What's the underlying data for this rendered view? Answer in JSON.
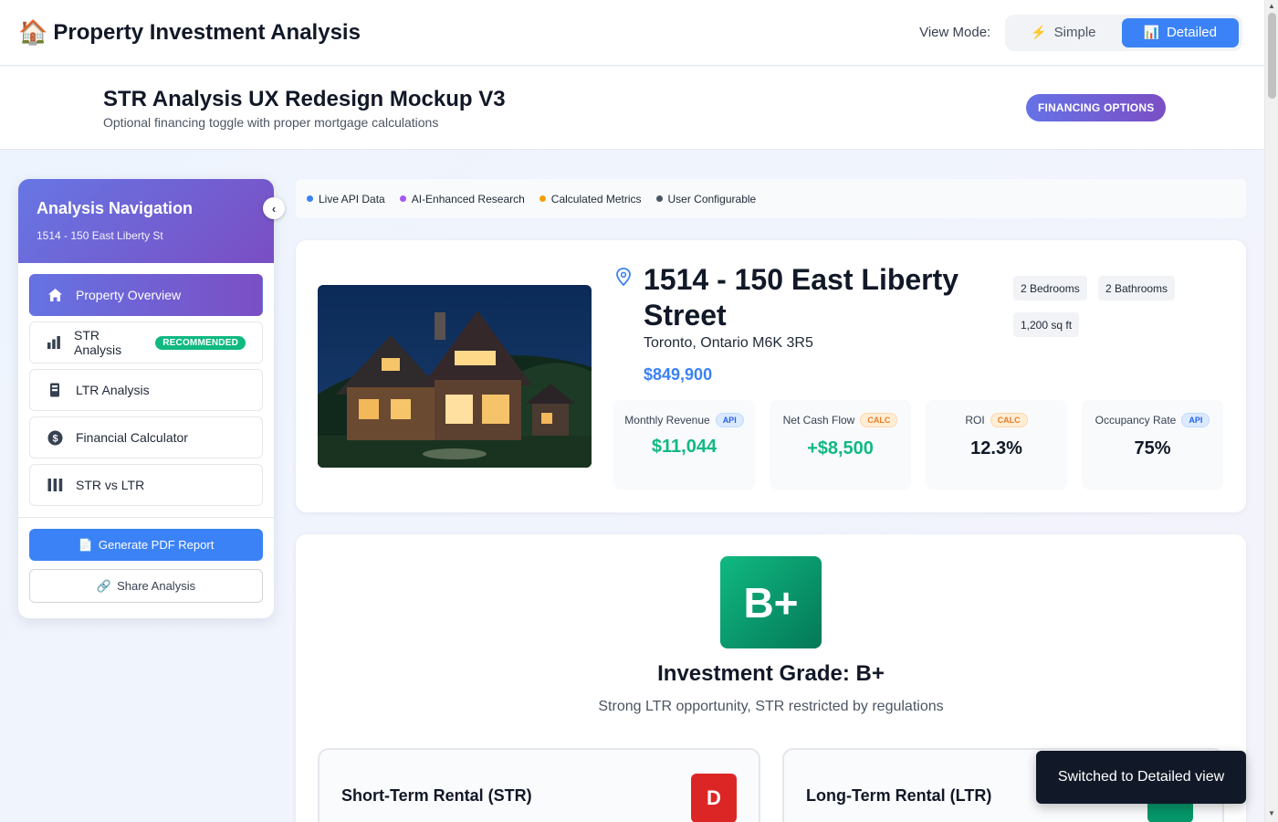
{
  "header": {
    "app_icon": "house-emoji",
    "app_emoji": "🏠",
    "app_title": "Property Investment Analysis",
    "view_mode_label": "View Mode:",
    "view_modes": [
      {
        "label": "Simple",
        "icon": "⚡",
        "active": false
      },
      {
        "label": "Detailed",
        "icon": "📊",
        "active": true
      }
    ]
  },
  "banner": {
    "title": "STR Analysis UX Redesign Mockup V3",
    "subtitle": "Optional financing toggle with proper mortgage calculations",
    "pill": "FINANCING OPTIONS"
  },
  "sidebar": {
    "title": "Analysis Navigation",
    "subtitle": "1514 - 150 East Liberty St",
    "collapse_glyph": "‹",
    "items": [
      {
        "label": "Property Overview",
        "icon": "home-icon",
        "active": true
      },
      {
        "label": "STR Analysis",
        "icon": "bar-chart-icon",
        "badge": "RECOMMENDED"
      },
      {
        "label": "LTR Analysis",
        "icon": "building-icon"
      },
      {
        "label": "Financial Calculator",
        "icon": "dollar-icon"
      },
      {
        "label": "STR vs LTR",
        "icon": "compare-columns-icon"
      }
    ],
    "pdf_button": "Generate PDF Report",
    "pdf_icon": "📄",
    "share_button": "Share Analysis",
    "share_icon": "🔗"
  },
  "legend": [
    {
      "label": "Live API Data",
      "color": "#3b82f6"
    },
    {
      "label": "AI-Enhanced Research",
      "color": "#a855f7"
    },
    {
      "label": "Calculated Metrics",
      "color": "#f59e0b"
    },
    {
      "label": "User Configurable",
      "color": "#4b5563"
    }
  ],
  "property": {
    "title": "1514 - 150 East Liberty Street",
    "address": "Toronto, Ontario M6K 3R5",
    "price": "$849,900",
    "chips": [
      "2 Bedrooms",
      "2 Bathrooms",
      "1,200 sq ft"
    ],
    "metrics": [
      {
        "label": "Monthly Revenue",
        "tag": "API",
        "value": "$11,044"
      },
      {
        "label": "Net Cash Flow",
        "tag": "CALC",
        "value": "+$8,500"
      },
      {
        "label": "ROI",
        "tag": "CALC",
        "value": "12.3%"
      },
      {
        "label": "Occupancy Rate",
        "tag": "API",
        "value": "75%"
      }
    ]
  },
  "grade": {
    "letter": "B+",
    "title": "Investment Grade: B+",
    "subtitle": "Strong LTR opportunity, STR restricted by regulations",
    "cards": [
      {
        "title": "Short-Term Rental (STR)",
        "grade": "D",
        "color": "#dc2626"
      },
      {
        "title": "Long-Term Rental (LTR)",
        "grade": "",
        "color": "#059669"
      }
    ]
  },
  "toast": "Switched to Detailed view"
}
